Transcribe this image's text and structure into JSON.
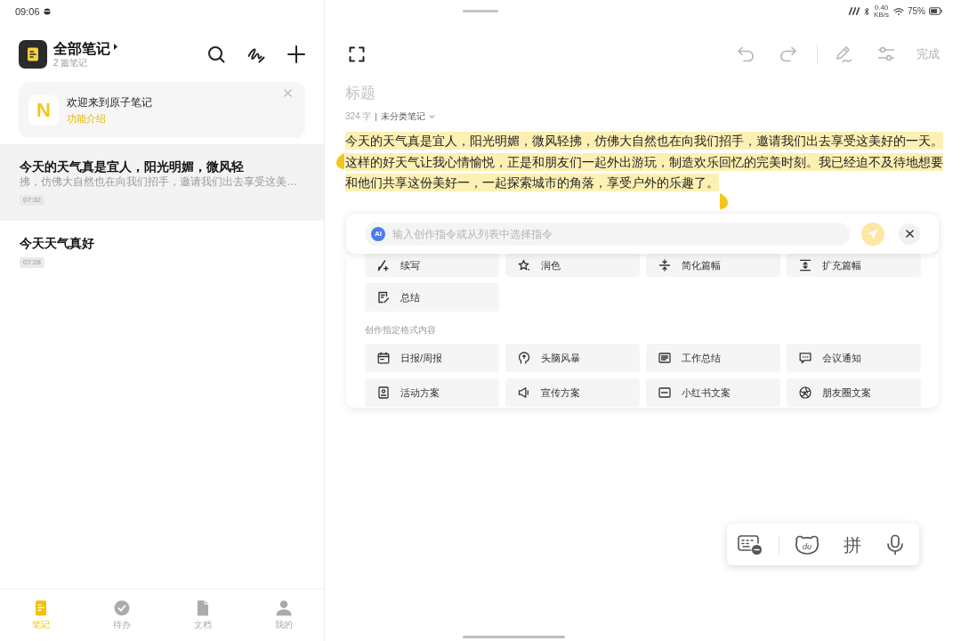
{
  "status_bar": {
    "time": "09:06",
    "network_speed": "0.40",
    "network_speed_unit": "KB/s",
    "battery": "75%"
  },
  "sidebar": {
    "header": {
      "title": "全部笔记",
      "subtitle": "2 篇笔记"
    },
    "welcome_card": {
      "logo": "N",
      "title": "欢迎来到原子笔记",
      "link": "功能介绍"
    },
    "notes": [
      {
        "title": "今天的天气真是宜人，阳光明媚，微风轻",
        "preview": "拂，仿佛大自然也在向我们招手，邀请我们出去享受这美…",
        "time": "07:32",
        "selected": true
      },
      {
        "title": "今天天气真好",
        "time": "07:28",
        "selected": false
      }
    ],
    "bottom_nav": [
      {
        "label": "笔记",
        "selected": true
      },
      {
        "label": "待办",
        "selected": false
      },
      {
        "label": "文档",
        "selected": false
      },
      {
        "label": "我的",
        "selected": false
      }
    ]
  },
  "editor": {
    "done": "完成",
    "title": {
      "placeholder": "标题"
    },
    "word_count": "324 字",
    "category": "未分类笔记",
    "body": {
      "text": "今天的天气真是宜人，阳光明媚，微风轻拂，仿佛大自然也在向我们招手，邀请我们出去享受这美好的一天。这样的好天气让我心情愉悦，正是和朋友们一起外出游玩，制造欢乐回忆的完美时刻。我已经迫不及待地想要和他们共享这份美好一，一起探索城市的角落，享受户外的乐趣了。",
      "selected": true
    }
  },
  "ai_panel": {
    "badge": "AI",
    "input": {
      "placeholder": "输入创作指令或从列表中选择指令"
    },
    "actions": [
      {
        "label": "续写"
      },
      {
        "label": "润色"
      },
      {
        "label": "简化篇幅"
      },
      {
        "label": "扩充篇幅"
      },
      {
        "label": "总结"
      }
    ],
    "section_label": "创作指定格式内容",
    "templates": [
      {
        "label": "日报/周报"
      },
      {
        "label": "头脑风暴"
      },
      {
        "label": "工作总结"
      },
      {
        "label": "会议通知"
      },
      {
        "label": "活动方案"
      },
      {
        "label": "宣传方案"
      },
      {
        "label": "小红书文案"
      },
      {
        "label": "朋友圈文案"
      }
    ]
  },
  "keyboard_toolbar": {
    "bear_label": "du",
    "input_method": "拼"
  }
}
